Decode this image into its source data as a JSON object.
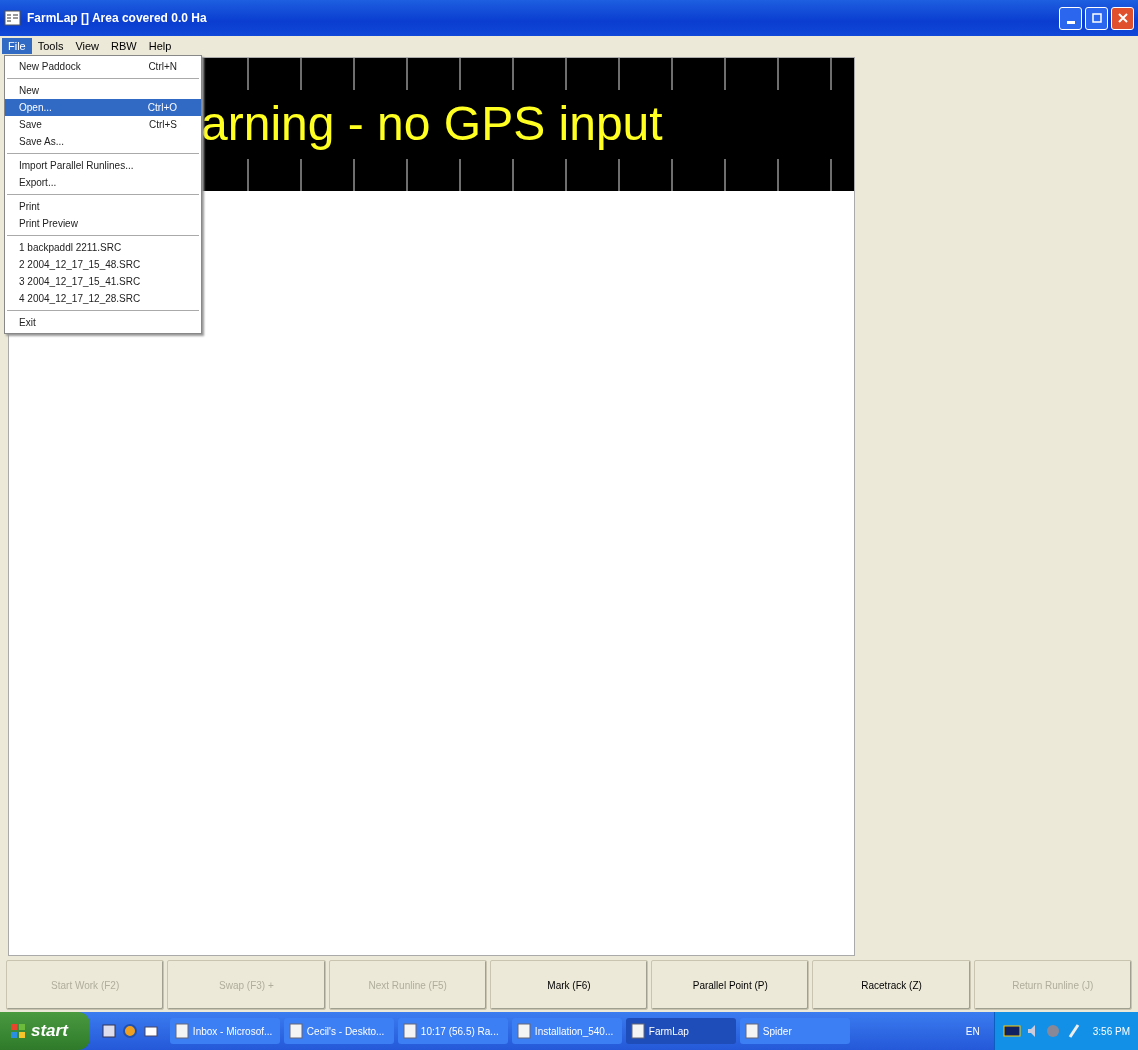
{
  "window": {
    "title": "FarmLap [] Area covered 0.0 Ha"
  },
  "menu_bar": [
    {
      "label": "File",
      "selected": true
    },
    {
      "label": "Tools",
      "selected": false
    },
    {
      "label": "View",
      "selected": false
    },
    {
      "label": "RBW",
      "selected": false
    },
    {
      "label": "Help",
      "selected": false
    }
  ],
  "file_menu": [
    {
      "kind": "item",
      "label": "New Paddock",
      "shortcut": "Ctrl+N",
      "selected": false
    },
    {
      "kind": "separator"
    },
    {
      "kind": "item",
      "label": "New",
      "selected": false
    },
    {
      "kind": "item",
      "label": "Open...",
      "shortcut": "Ctrl+O",
      "selected": true
    },
    {
      "kind": "item",
      "label": "Save",
      "shortcut": "Ctrl+S",
      "selected": false
    },
    {
      "kind": "item",
      "label": "Save As...",
      "selected": false
    },
    {
      "kind": "separator"
    },
    {
      "kind": "item",
      "label": "Import Parallel Runlines...",
      "selected": false
    },
    {
      "kind": "item",
      "label": "Export...",
      "selected": false
    },
    {
      "kind": "separator"
    },
    {
      "kind": "item",
      "label": "Print",
      "selected": false
    },
    {
      "kind": "item",
      "label": "Print Preview",
      "selected": false
    },
    {
      "kind": "separator"
    },
    {
      "kind": "item",
      "label": "1  backpaddl 2211.SRC",
      "selected": false
    },
    {
      "kind": "item",
      "label": "2  2004_12_17_15_48.SRC",
      "selected": false
    },
    {
      "kind": "item",
      "label": "3  2004_12_17_15_41.SRC",
      "selected": false
    },
    {
      "kind": "item",
      "label": "4  2004_12_17_12_28.SRC",
      "selected": false
    },
    {
      "kind": "separator"
    },
    {
      "kind": "item",
      "label": "Exit",
      "selected": false
    }
  ],
  "banner": {
    "text": "arning - no GPS input"
  },
  "buttons": [
    {
      "label": "Start Work (F2)",
      "disabled": true
    },
    {
      "label": "Swap (F3) +",
      "disabled": true
    },
    {
      "label": "Next Runline (F5)",
      "disabled": true
    },
    {
      "label": "Mark (F6)",
      "disabled": false
    },
    {
      "label": "Parallel Point (P)",
      "disabled": false
    },
    {
      "label": "Racetrack (Z)",
      "disabled": false
    },
    {
      "label": "Return Runline (J)",
      "disabled": true
    }
  ],
  "taskbar": {
    "start": "start",
    "tasks": [
      {
        "label": "Inbox - Microsof...",
        "selected": false
      },
      {
        "label": "Cecil's - Deskto...",
        "selected": false
      },
      {
        "label": "10:17 (56.5) Ra...",
        "selected": false
      },
      {
        "label": "Installation_540...",
        "selected": false
      },
      {
        "label": "FarmLap",
        "selected": true
      },
      {
        "label": "Spider",
        "selected": false
      }
    ],
    "language": "EN",
    "clock": "3:56 PM"
  }
}
